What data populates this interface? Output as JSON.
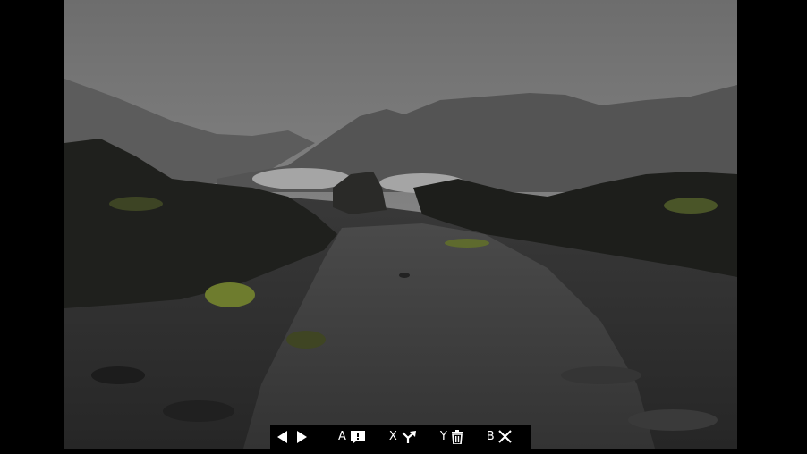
{
  "controls": {
    "a": {
      "key": "A",
      "icon": "report-icon"
    },
    "x": {
      "key": "X",
      "icon": "share-icon"
    },
    "y": {
      "key": "Y",
      "icon": "trash-icon"
    },
    "b": {
      "key": "B",
      "icon": "close-icon"
    }
  },
  "colors": {
    "sky": "#7a7a7a",
    "mountain": "#4a4a4a",
    "ground": "#2b2b2b",
    "moss": "#7f8c3a",
    "overlay_bg": "#000000",
    "overlay_fg": "#ffffff"
  }
}
